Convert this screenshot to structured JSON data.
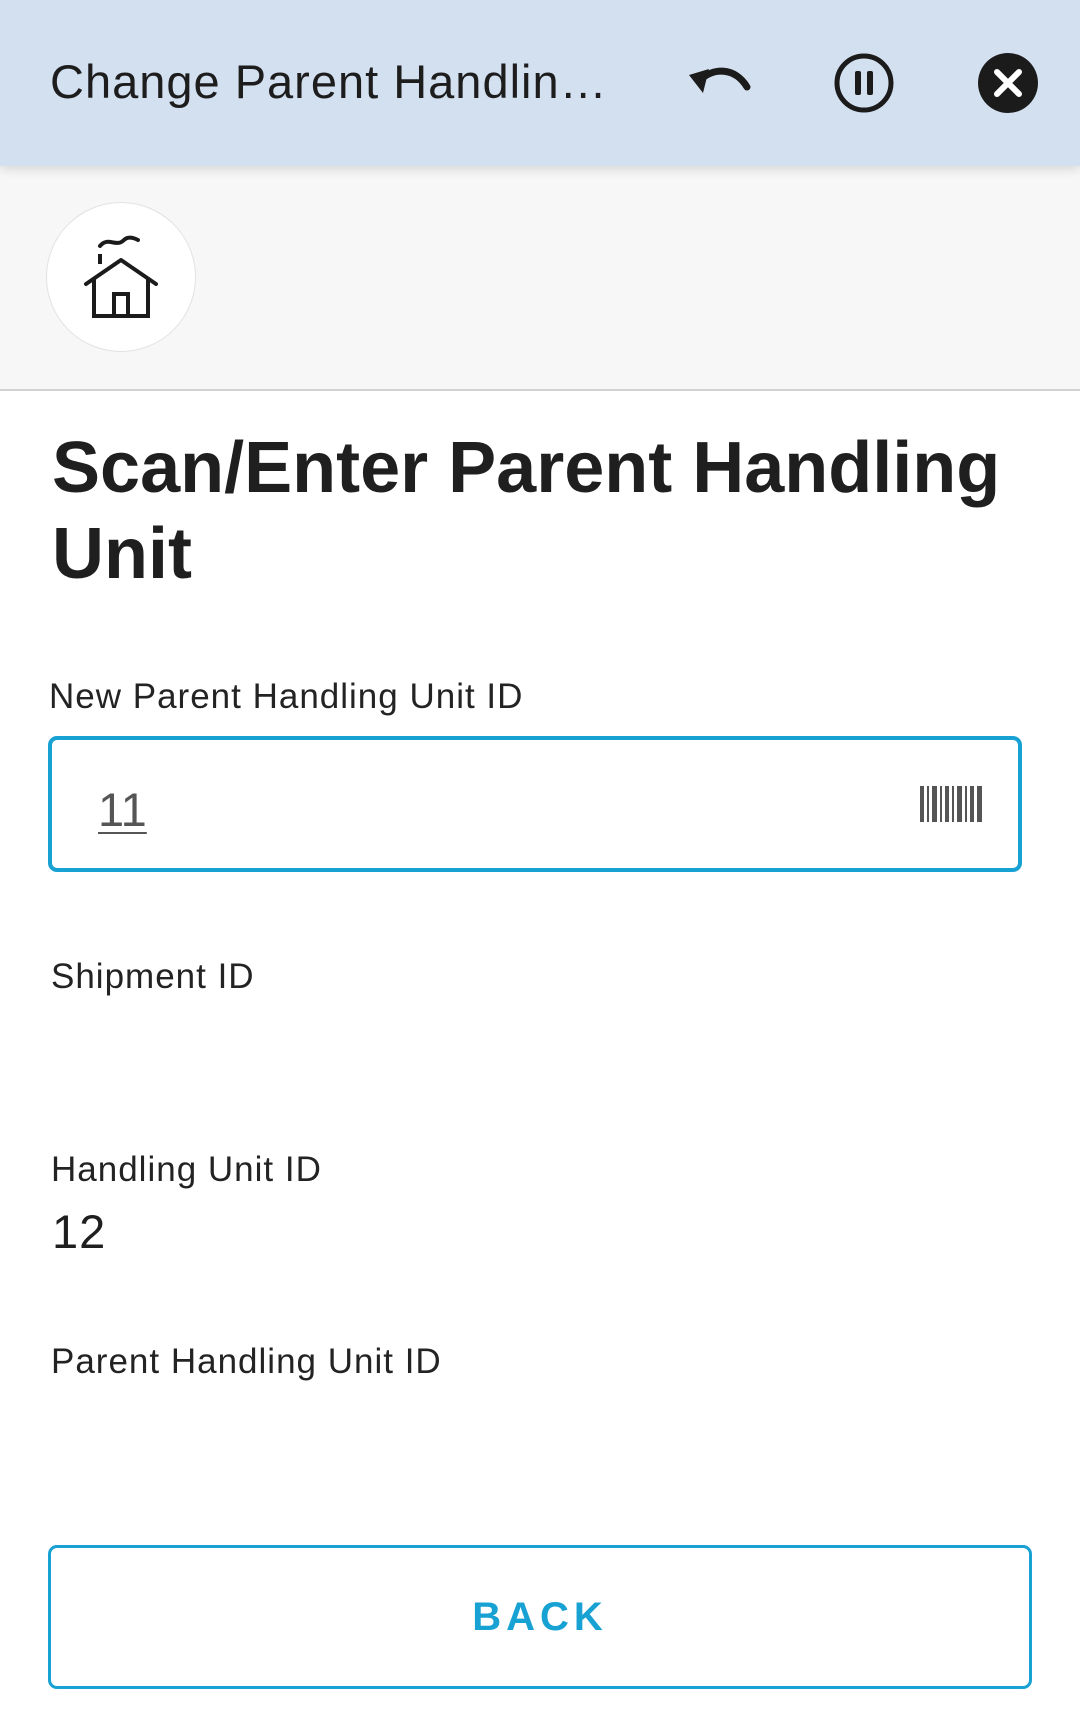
{
  "header": {
    "title": "Change Parent Handling Unit",
    "undo_icon": "undo-icon",
    "pause_icon": "pause-circle-icon",
    "close_icon": "close-circle-icon",
    "background_color": "#d3e0f0"
  },
  "home": {
    "icon": "home-icon"
  },
  "main": {
    "heading": "Scan/Enter Parent Handling Unit",
    "fields": {
      "new_parent_hu": {
        "label": "New Parent Handling Unit ID",
        "value": "11",
        "icon": "barcode-icon"
      },
      "shipment": {
        "label": "Shipment ID",
        "value": ""
      },
      "handling_unit": {
        "label": "Handling Unit ID",
        "value": "12"
      },
      "parent_hu": {
        "label": "Parent Handling Unit ID",
        "value": ""
      }
    },
    "back_label": "BACK"
  },
  "colors": {
    "accent": "#18a1d3",
    "text": "#1f1f1f"
  }
}
